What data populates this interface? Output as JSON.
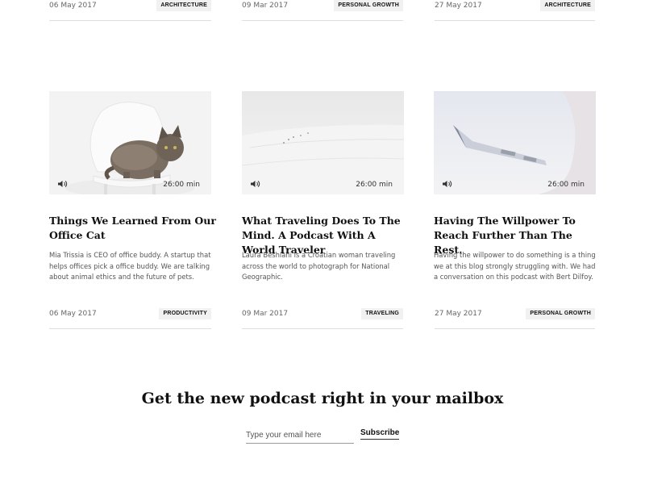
{
  "top_row": [
    {
      "date": "06 May 2017",
      "tag": "ARCHITECTURE"
    },
    {
      "date": "09 Mar 2017",
      "tag": "PERSONAL GROWTH"
    },
    {
      "date": "27 May 2017",
      "tag": "ARCHITECTURE"
    }
  ],
  "cards": [
    {
      "image_icon": "cat-on-chair-image",
      "duration": "26:00 min",
      "title": "Things We Learned From Our Office Cat",
      "excerpt": "Mia Trissia is CEO of office buddy. A startup that helps offices pick a office buddy. We are talking about animal ethics and the future of pets.",
      "date": "06 May 2017",
      "tag": "PRODUCTIVITY"
    },
    {
      "image_icon": "snowy-landscape-image",
      "duration": "26:00 min",
      "title": "What Traveling Does To The Mind. A Podcast With A World Traveler",
      "excerpt": "Laura Beshiani is a Croatian woman traveling across the world to photograph for National Geographic.",
      "date": "09 Mar 2017",
      "tag": "TRAVELING"
    },
    {
      "image_icon": "airplane-window-image",
      "duration": "26:00 min",
      "title": "Having The Willpower To Reach Further Than The Rest.",
      "excerpt": "Having the willpower to do something is a thing we at this blog strongly struggling with. We had a conversation on this podcast with Bert Dilfoy.",
      "date": "27 May 2017",
      "tag": "PERSONAL GROWTH"
    }
  ],
  "newsletter": {
    "title": "Get the new podcast right in your mailbox",
    "placeholder": "Type your email here",
    "button": "Subscribe"
  }
}
